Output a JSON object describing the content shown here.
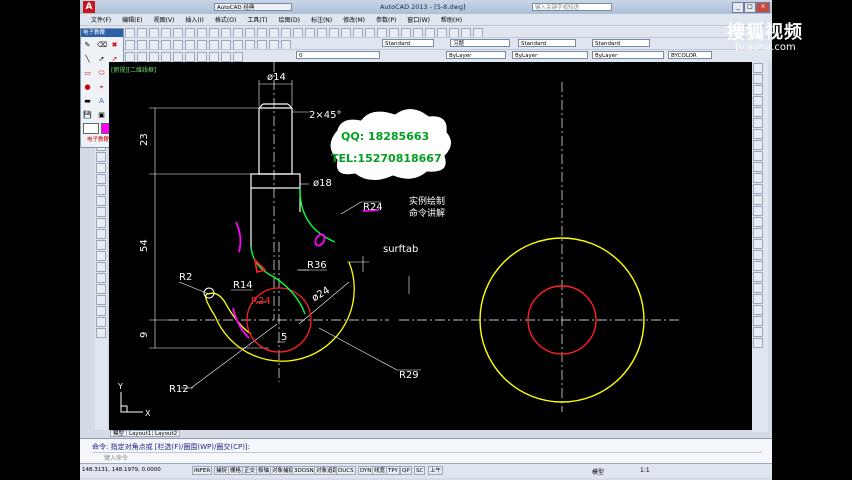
{
  "window": {
    "title": "AutoCAD 2013 - [5-8.dwg]",
    "workspace": "AutoCAD 经典",
    "search_placeholder": "键入关键字或短语"
  },
  "menu": [
    "文件(F)",
    "编辑(E)",
    "视图(V)",
    "插入(I)",
    "格式(O)",
    "工具(T)",
    "绘图(D)",
    "标注(N)",
    "修改(M)",
    "参数(P)",
    "窗口(W)",
    "帮助(H)"
  ],
  "toolbar": {
    "layer_value": "0",
    "text_style": "Standard",
    "dim_style": "习题",
    "table_style": "Standard",
    "mleader_style": "Standard",
    "color": "ByLayer",
    "linetype": "ByLayer",
    "lineweight": "ByLayer",
    "plotstyle": "BYCOLOR"
  },
  "palette": {
    "title": "电子教鞭",
    "footer": "电子教鞭"
  },
  "watermark": {
    "brand": "搜狐视频",
    "url": "tv.sohu.com"
  },
  "canvas": {
    "viewport_label": "[俯视][二维线框]",
    "dims": {
      "d14": "ø14",
      "chamfer": "2×45°",
      "d18": "ø18",
      "h23": "23",
      "h54": "54",
      "h9": "9",
      "r24_top": "R24",
      "r36": "R36",
      "r2": "R2",
      "r14": "R14",
      "r24_mid": "R24",
      "d24": "ø24",
      "five": "5",
      "r12": "R12",
      "r29": "R29"
    },
    "cloud_qq": "QQ: 18285663",
    "cloud_tel": "TEL:15270818667",
    "note1": "实例绘制",
    "note2": "命令讲解",
    "surftab": "surftab",
    "ucs_x": "X",
    "ucs_y": "Y"
  },
  "tabs": [
    "模型",
    "Layout1",
    "Layout2"
  ],
  "command": {
    "line1": "命令: 指定对角点或 [栏选(F)/圈围(WP)/圈交(CP)]:",
    "prompt": "键入命令"
  },
  "status": {
    "coords": "148.3131, 148.1979, 0.0000",
    "buttons": [
      "INFER",
      "捕捉",
      "栅格",
      "正交",
      "极轴",
      "对象捕捉",
      "3DOSNAP",
      "对象追踪",
      "DUCS",
      "DYN",
      "线宽",
      "TPY",
      "QP",
      "SC",
      "上午"
    ],
    "model": "模型",
    "scale": "1:1"
  },
  "colors": {
    "hook_outline": "#ffff00",
    "center_circle": "#ff2020",
    "green_arc": "#00ff40",
    "magenta": "#ff00ff",
    "dimension": "#ffffff"
  }
}
